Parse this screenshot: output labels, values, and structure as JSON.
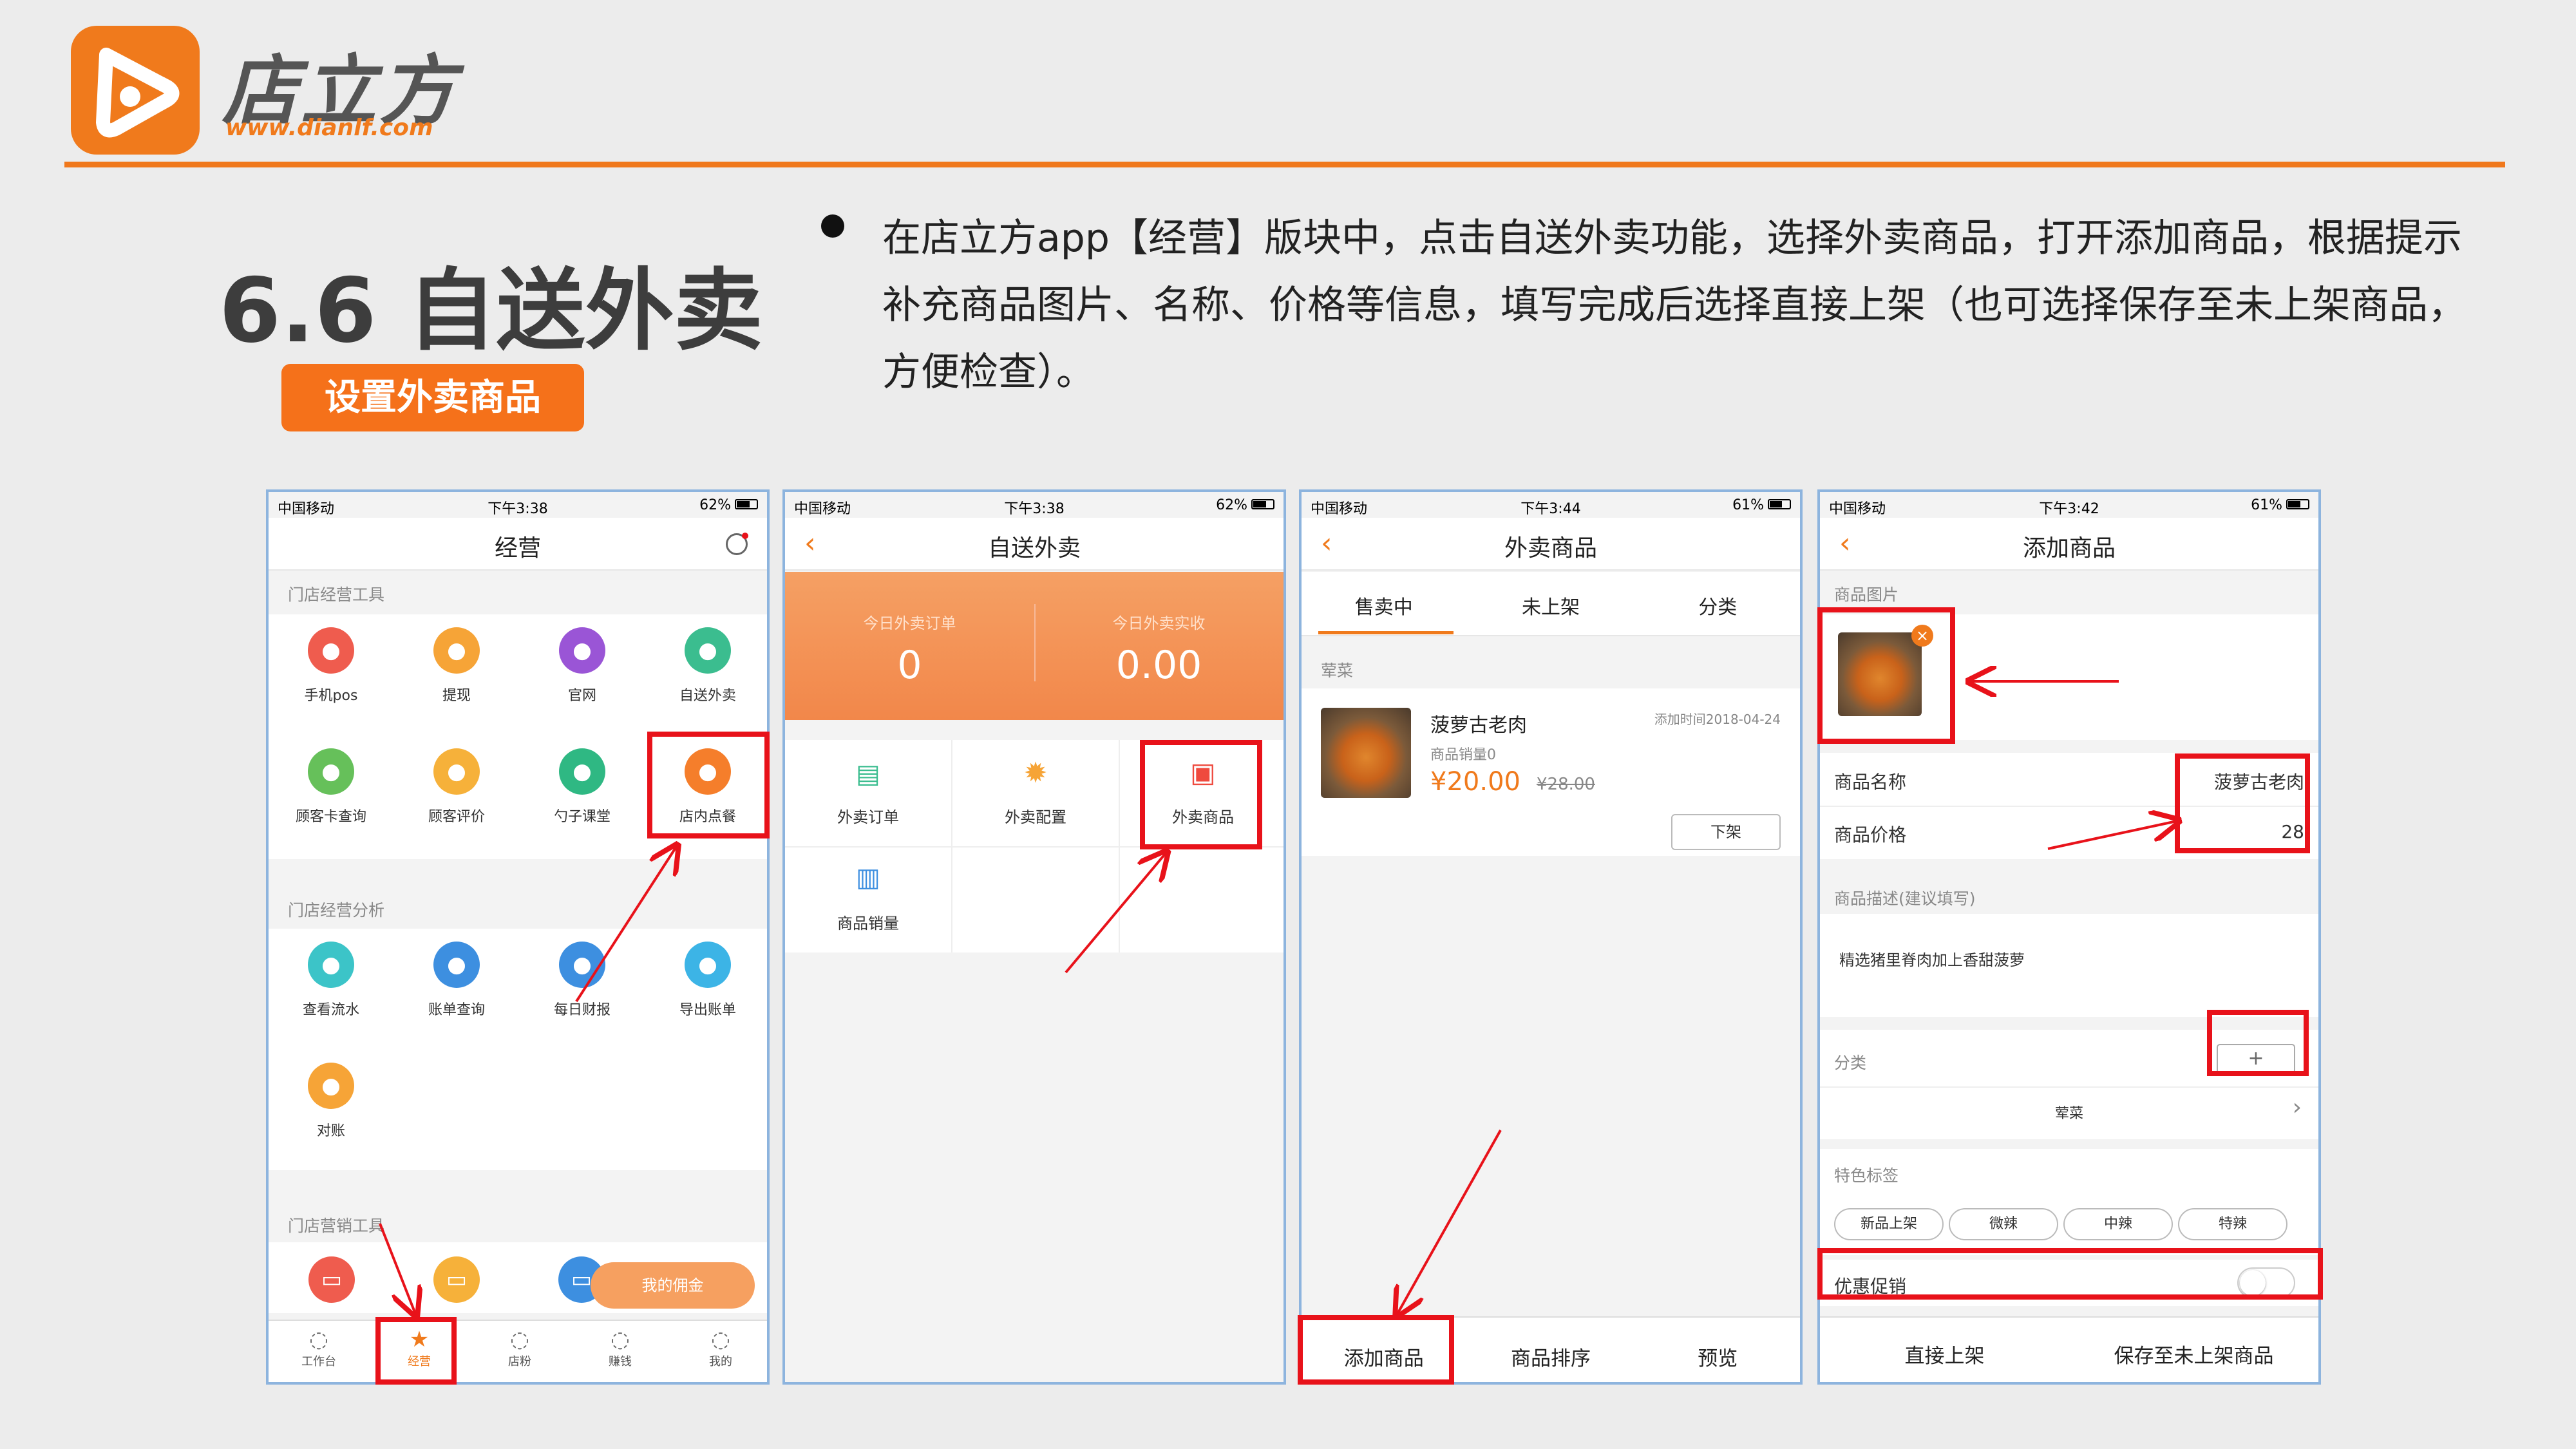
{
  "brand": {
    "name": "店立方",
    "url": "www.dianlf.com",
    "accent": "#f07a1c",
    "mark_red": "#e8121a"
  },
  "section": {
    "title": "6.6 自送外卖",
    "badge": "设置外卖商品"
  },
  "description": "在店立方app【经营】版块中，点击自送外卖功能，选择外卖商品，打开添加商品，根据提示补充商品图片、名称、价格等信息，填写完成后选择直接上架（也可选择保存至未上架商品，方便检查）。",
  "phone1": {
    "status": {
      "carrier": "中国移动",
      "time": "下午3:38",
      "battery": "62%",
      "battery_level": 0.62
    },
    "title": "经营",
    "groups": [
      {
        "label": "门店经营工具",
        "items": [
          {
            "label": "手机pos",
            "icon": "scan-icon",
            "color": "#ef5c4e"
          },
          {
            "label": "提现",
            "icon": "wallet-icon",
            "color": "#f6a437"
          },
          {
            "label": "官网",
            "icon": "monitor-icon",
            "color": "#9a55d6"
          },
          {
            "label": "自送外卖",
            "icon": "cutlery-icon",
            "color": "#3bbd8f"
          },
          {
            "label": "顾客卡查询",
            "icon": "card-icon",
            "color": "#66c05a"
          },
          {
            "label": "顾客评价",
            "icon": "chat-icon",
            "color": "#f6b13a"
          },
          {
            "label": "勺子课堂",
            "icon": "leaf-icon",
            "color": "#2fb883"
          },
          {
            "label": "店内点餐",
            "icon": "cloche-icon",
            "color": "#f57e2b"
          }
        ]
      },
      {
        "label": "门店经营分析",
        "items": [
          {
            "label": "查看流水",
            "icon": "yen-icon",
            "color": "#3cc4c8"
          },
          {
            "label": "账单查询",
            "icon": "doc-icon",
            "color": "#3d8fe0"
          },
          {
            "label": "每日财报",
            "icon": "pie-icon",
            "color": "#3d8fe0"
          },
          {
            "label": "导出账单",
            "icon": "share-icon",
            "color": "#3cb4e6"
          },
          {
            "label": "对账",
            "icon": "ledger-icon",
            "color": "#f6a437"
          }
        ]
      },
      {
        "label": "门店营销工具"
      }
    ],
    "commission_button": "我的佣金",
    "tabbar": [
      "工作台",
      "经营",
      "店粉",
      "赚钱",
      "我的"
    ]
  },
  "phone2": {
    "status": {
      "carrier": "中国移动",
      "time": "下午3:38",
      "battery": "62%",
      "battery_level": 0.62
    },
    "title": "自送外卖",
    "stats": [
      {
        "label": "今日外卖订单",
        "value": "0"
      },
      {
        "label": "今日外卖实收",
        "value": "0.00"
      }
    ],
    "menu": [
      {
        "label": "外卖订单",
        "icon": "order-icon"
      },
      {
        "label": "外卖配置",
        "icon": "gear-icon"
      },
      {
        "label": "外卖商品",
        "icon": "bag-icon"
      },
      {
        "label": "商品销量",
        "icon": "bar-chart-icon"
      }
    ]
  },
  "phone3": {
    "status": {
      "carrier": "中国移动",
      "time": "下午3:44",
      "battery": "61%",
      "battery_level": 0.61
    },
    "title": "外卖商品",
    "tabs": [
      "售卖中",
      "未上架",
      "分类"
    ],
    "category": "荤菜",
    "product": {
      "name": "菠萝古老肉",
      "added": "添加时间2018-04-24",
      "sales": "商品销量0",
      "price": "¥20.00",
      "old_price": "¥28.00",
      "action": "下架"
    },
    "bottom": [
      "添加商品",
      "商品排序",
      "预览"
    ]
  },
  "phone4": {
    "status": {
      "carrier": "中国移动",
      "time": "下午3:42",
      "battery": "61%",
      "battery_level": 0.61
    },
    "title": "添加商品",
    "image_label": "商品图片",
    "name_label": "商品名称",
    "name_value": "菠萝古老肉",
    "price_label": "商品价格",
    "price_value": "28",
    "desc_label": "商品描述(建议填写)",
    "desc_value": "精选猪里脊肉加上香甜菠萝",
    "category_label": "分类",
    "category_value": "荤菜",
    "tags_label": "特色标签",
    "tags": [
      "新品上架",
      "微辣",
      "中辣",
      "特辣"
    ],
    "promo_label": "优惠促销",
    "bottom": [
      "直接上架",
      "保存至未上架商品"
    ]
  }
}
